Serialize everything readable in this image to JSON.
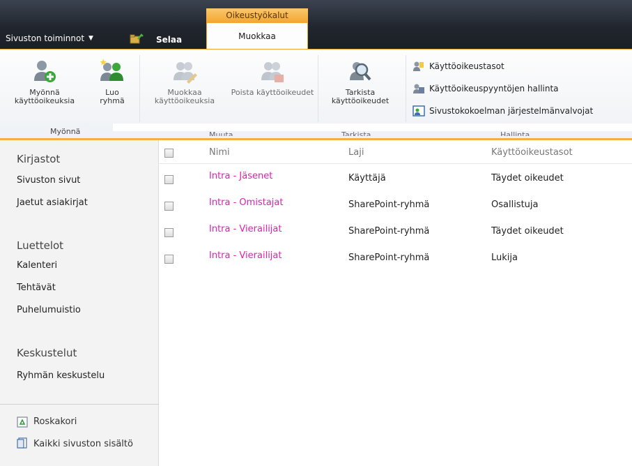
{
  "topbar": {
    "site_actions": "Sivuston toiminnot",
    "context_label": "Oikeustyökalut",
    "tabs": [
      {
        "label": "Selaa"
      },
      {
        "label": "Muokkaa"
      }
    ]
  },
  "ribbon": {
    "buttons": {
      "grant": "Myönnä käyttöoikeuksia",
      "create_group": "Luo ryhmä",
      "edit_perms": "Muokkaa käyttöoikeuksia",
      "remove_perms": "Poista käyttöoikeudet",
      "check_perms": "Tarkista käyttöoikeudet"
    },
    "small_buttons": [
      {
        "label": "Käyttöoikeustasot"
      },
      {
        "label": "Käyttöoikeuspyyntöjen hallinta"
      },
      {
        "label": "Sivustokokoelman järjestelmänvalvojat"
      }
    ],
    "groups": {
      "grant": "Myönnä",
      "modify": "Muuta",
      "check": "Tarkista",
      "manage": "Hallinta"
    }
  },
  "leftnav": {
    "libraries_heading": "Kirjastot",
    "libraries": [
      "Sivuston sivut",
      "Jaetut asiakirjat"
    ],
    "lists_heading": "Luettelot",
    "lists": [
      "Kalenteri",
      "Tehtävät",
      "Puhelumuistio"
    ],
    "discussions_heading": "Keskustelut",
    "discussions": [
      "Ryhmän keskustelu"
    ],
    "recycle_bin": "Roskakori",
    "all_content": "Kaikki sivuston sisältö"
  },
  "table": {
    "headers": {
      "name": "Nimi",
      "type": "Laji",
      "levels": "Käyttöoikeustasot"
    },
    "rows": [
      {
        "name": "Intra - Jäsenet",
        "type": "Käyttäjä",
        "level": "Täydet oikeudet"
      },
      {
        "name": "Intra - Omistajat",
        "type": "SharePoint-ryhmä",
        "level": "Osallistuja"
      },
      {
        "name": "Intra - Vierailijat",
        "type": "SharePoint-ryhmä",
        "level": "Täydet oikeudet"
      },
      {
        "name": "Intra - Vierailijat",
        "type": "SharePoint-ryhmä",
        "level": "Lukija"
      }
    ]
  },
  "colors": {
    "accent": "#f3a731",
    "link": "#e21fb0",
    "topbar": "#21262e"
  }
}
